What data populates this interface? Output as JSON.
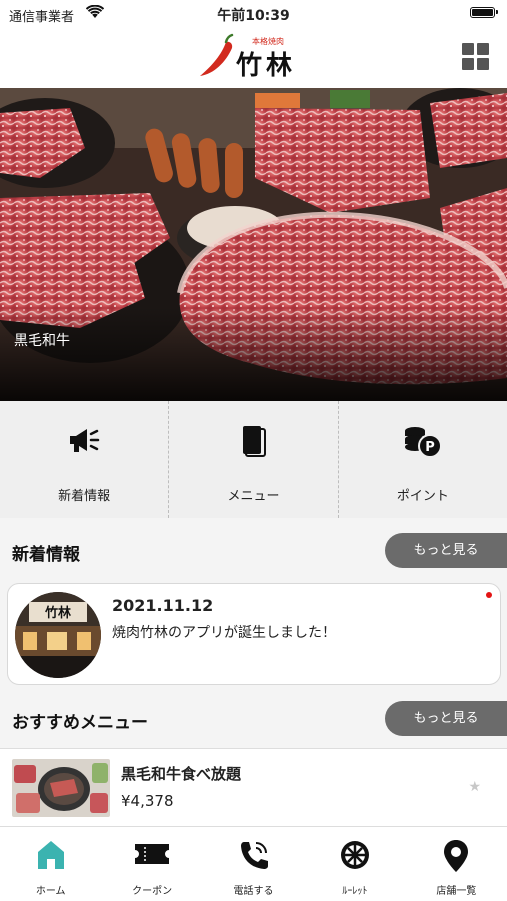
{
  "status_bar": {
    "carrier": "通信事業者",
    "time": "午前10:39"
  },
  "header": {
    "logo_small_text": "本格焼肉",
    "logo_main_text": "竹林"
  },
  "hero": {
    "caption": "黒毛和牛"
  },
  "quick_menu": [
    {
      "label": "新着情報",
      "icon": "megaphone-icon"
    },
    {
      "label": "メニュー",
      "icon": "book-icon"
    },
    {
      "label": "ポイント",
      "icon": "coins-point-icon"
    }
  ],
  "news_section": {
    "title": "新着情報",
    "more_label": "もっと見る",
    "items": [
      {
        "date": "2021.11.12",
        "text": "焼肉竹林のアプリが誕生しました！",
        "unread": true
      }
    ]
  },
  "recommend_section": {
    "title": "おすすめメニュー",
    "more_label": "もっと見る",
    "items": [
      {
        "name": "黒毛和牛食べ放題",
        "price": "¥4,378"
      }
    ]
  },
  "tabbar": [
    {
      "label": "ホーム",
      "icon": "home-icon",
      "active": true,
      "color": "#3bb3b0"
    },
    {
      "label": "クーポン",
      "icon": "ticket-icon"
    },
    {
      "label": "電話する",
      "icon": "phone-icon"
    },
    {
      "label": "ﾙｰﾚｯﾄ",
      "icon": "roulette-icon"
    },
    {
      "label": "店舗一覧",
      "icon": "map-pin-icon"
    }
  ],
  "colors": {
    "accent": "#3bb3b0",
    "more_button": "#6b6b6b",
    "unread_dot": "#e31414",
    "logo_red": "#d22a1e"
  }
}
